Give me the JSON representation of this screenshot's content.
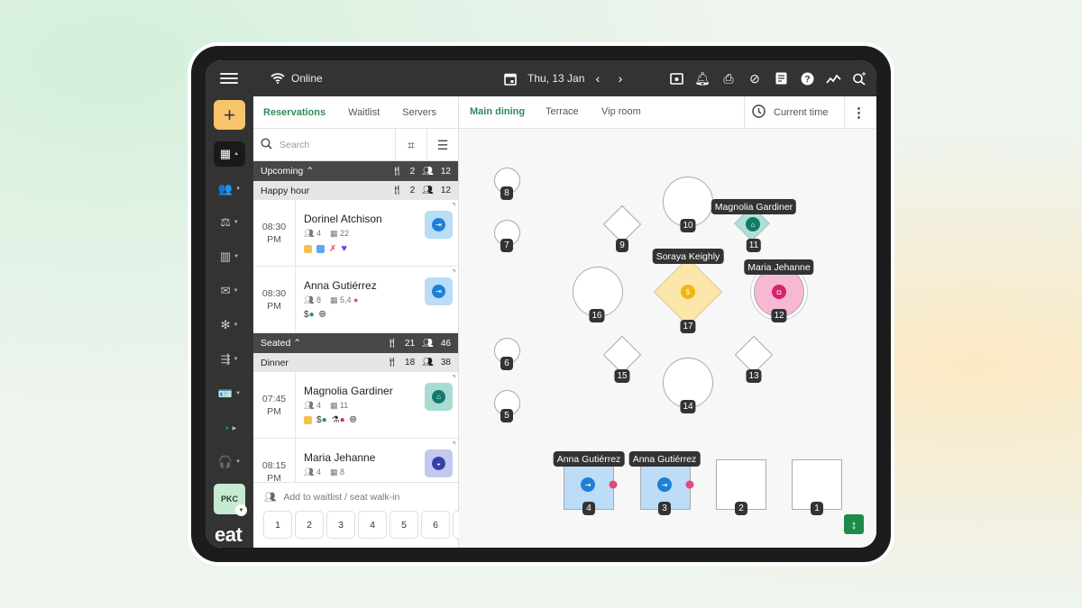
{
  "topbar": {
    "status": "Online",
    "date": "Thu, 13 Jan",
    "icons": [
      "preview-icon",
      "bell-icon",
      "print-icon",
      "block-icon",
      "notes-icon",
      "help-icon",
      "analytics-icon",
      "search-sparkle-icon"
    ]
  },
  "rail": {
    "items": [
      "floorplan",
      "guests",
      "servers",
      "reports",
      "messages",
      "integrations",
      "flows",
      "staff",
      "performance",
      "support"
    ],
    "account": "PKC",
    "logo": "eat"
  },
  "left_tabs": [
    {
      "label": "Reservations",
      "active": true
    },
    {
      "label": "Waitlist",
      "active": false
    },
    {
      "label": "Servers",
      "active": false
    }
  ],
  "search": {
    "placeholder": "Search"
  },
  "sections": {
    "upcoming": {
      "label": "Upcoming",
      "covers": "2",
      "guests": "12"
    },
    "happy_hour": {
      "label": "Happy hour",
      "covers": "2",
      "guests": "12"
    },
    "seated": {
      "label": "Seated",
      "covers": "21",
      "guests": "46"
    },
    "dinner": {
      "label": "Dinner",
      "covers": "18",
      "guests": "38"
    }
  },
  "reservations": [
    {
      "time": "08:30",
      "ampm": "PM",
      "name": "Dorinel Atchison",
      "party": "4",
      "table": "22",
      "status_color": "#b9dcf7",
      "status_dot": "#1f7fd6"
    },
    {
      "time": "08:30",
      "ampm": "PM",
      "name": "Anna Gutiérrez",
      "party": "8",
      "table": "5,4",
      "status_color": "#b9dcf7",
      "status_dot": "#1f7fd6"
    },
    {
      "time": "07:45",
      "ampm": "PM",
      "name": "Magnolia Gardiner",
      "party": "4",
      "table": "11",
      "status_color": "#a8dcd3",
      "status_dot": "#137b6a"
    },
    {
      "time": "08:15",
      "ampm": "PM",
      "name": "Maria Jehanne",
      "party": "4",
      "table": "8",
      "status_color": "#c3c8ee",
      "status_dot": "#3442a8"
    }
  ],
  "walkin": {
    "label": "Add to waitlist / seat walk-in",
    "party_sizes": [
      "1",
      "2",
      "3",
      "4",
      "5",
      "6"
    ]
  },
  "floor_tabs": [
    {
      "label": "Main dining",
      "active": true
    },
    {
      "label": "Terrace",
      "active": false
    },
    {
      "label": "Vip room",
      "active": false
    }
  ],
  "current_time_label": "Current time",
  "tables": [
    {
      "id": "8"
    },
    {
      "id": "7"
    },
    {
      "id": "6"
    },
    {
      "id": "5"
    },
    {
      "id": "9"
    },
    {
      "id": "10"
    },
    {
      "id": "11",
      "guest": "Magnolia Gardiner"
    },
    {
      "id": "16"
    },
    {
      "id": "17",
      "guest": "Soraya Keighly"
    },
    {
      "id": "12",
      "guest": "Maria Jehanne"
    },
    {
      "id": "15"
    },
    {
      "id": "14"
    },
    {
      "id": "13"
    },
    {
      "id": "4",
      "guest": "Anna Gutiérrez"
    },
    {
      "id": "3",
      "guest": "Anna Gutiérrez"
    },
    {
      "id": "2"
    },
    {
      "id": "1"
    }
  ],
  "colors": {
    "accent": "#2e8b57",
    "dark": "#333333",
    "add": "#f7c46c"
  }
}
